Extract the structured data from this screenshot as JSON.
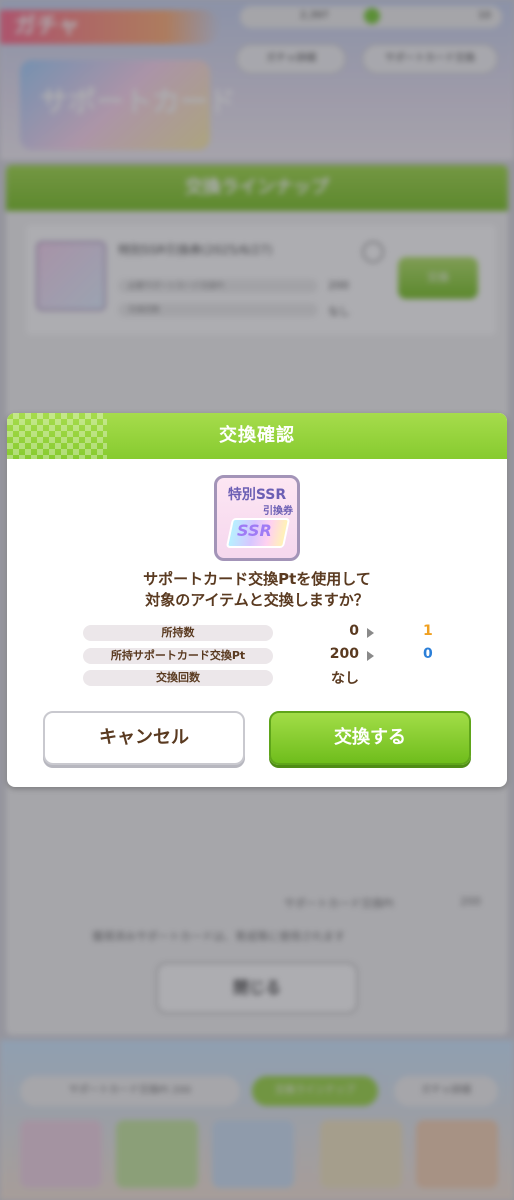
{
  "background": {
    "gacha_tag": "ガチャ",
    "currency_value": "2,397",
    "currency_right": "10",
    "top_buttons": [
      "ガチャ詳細",
      "サポートカード交換"
    ],
    "banner_text": "サポートカード",
    "panel_title": "交換ラインナップ",
    "item": {
      "title": "特別SSR引換券(2025/6/27)",
      "rows": [
        {
          "label": "必要サポートカード交換Pt",
          "value": "200"
        },
        {
          "label": "交換回数",
          "value": "なし"
        }
      ],
      "exchange_label": "交換"
    },
    "footer_pt_label": "サポートカード交換Pt",
    "footer_pt_value": "200",
    "footer_note": "獲得済みサポートカードは、育成等に使用されます",
    "close_label": "閉じる",
    "bottom_pt_label": "サポートカード交換Pt",
    "bottom_pt_value": "200",
    "bottom_lineup_label": "交換ラインナップ",
    "bottom_detail_label": "ガチャ詳細"
  },
  "modal": {
    "title": "交換確認",
    "ticket": {
      "line1": "特別SSR",
      "line2": "引換券",
      "badge": "SSR"
    },
    "question_line1": "サポートカード交換Ptを使用して",
    "question_line2": "対象のアイテムと交換しますか？",
    "rows": [
      {
        "label": "所持数",
        "before": "0",
        "after": "1",
        "after_color": "#f0a020"
      },
      {
        "label": "所持サポートカード交換Pt",
        "before": "200",
        "after": "0",
        "after_color": "#2b7fd8"
      },
      {
        "label": "交換回数",
        "before": "なし",
        "after": "",
        "after_color": "#5a3a20"
      }
    ],
    "cancel_label": "キャンセル",
    "confirm_label": "交換する"
  }
}
